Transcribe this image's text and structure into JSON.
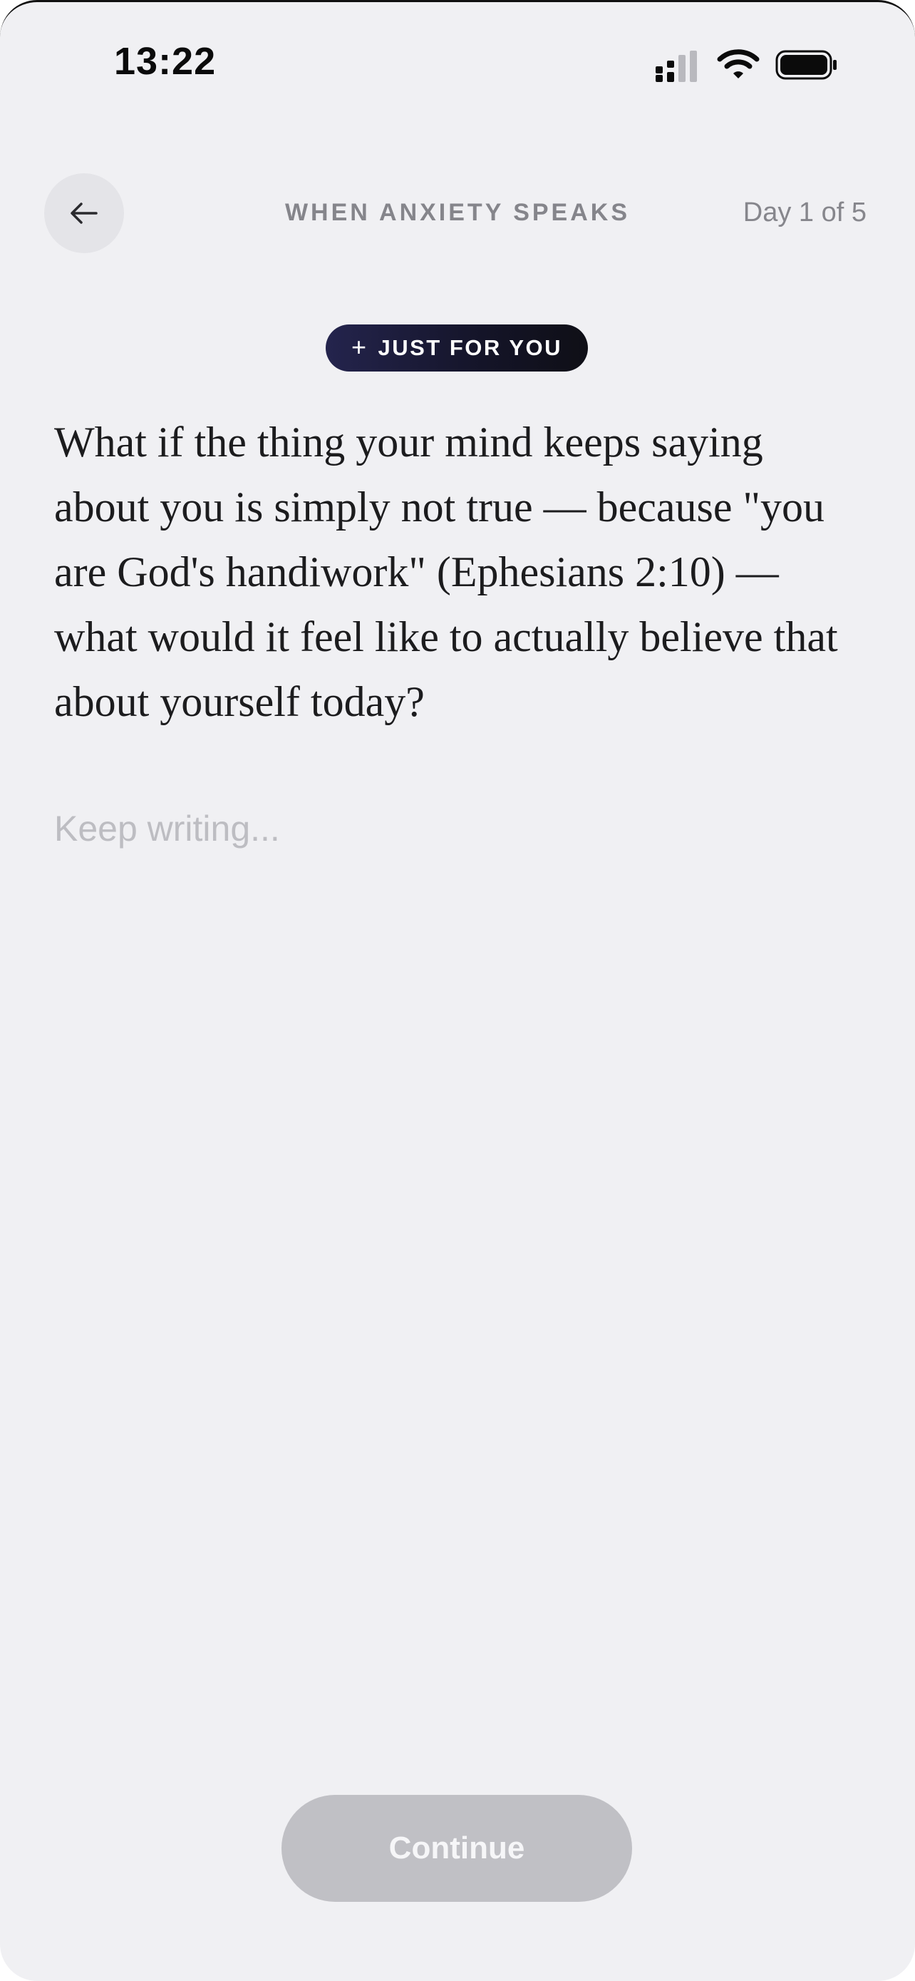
{
  "status_bar": {
    "time": "13:22",
    "icons": [
      "signal-icon",
      "wifi-icon",
      "battery-icon"
    ]
  },
  "header": {
    "back_icon": "arrow-left-icon",
    "title": "WHEN ANXIETY SPEAKS",
    "day_progress": "Day 1 of 5"
  },
  "badge": {
    "icon": "+",
    "label": "JUST FOR YOU"
  },
  "prompt": {
    "text": "What if the thing your mind keeps saying about you is simply not true — because \"you are God's handiwork\" (Ephesians 2:10) — what would it feel like to actually believe that about yourself today?"
  },
  "journal": {
    "value": "",
    "placeholder": "Keep writing..."
  },
  "footer": {
    "continue_label": "Continue"
  },
  "colors": {
    "background": "#f0f0f3",
    "badge_gradient_start": "#24244d",
    "badge_gradient_end": "#0f0f16",
    "button_disabled": "#c0c0c5",
    "title_gray": "#85858b",
    "text_dark": "#1c1c1e"
  }
}
